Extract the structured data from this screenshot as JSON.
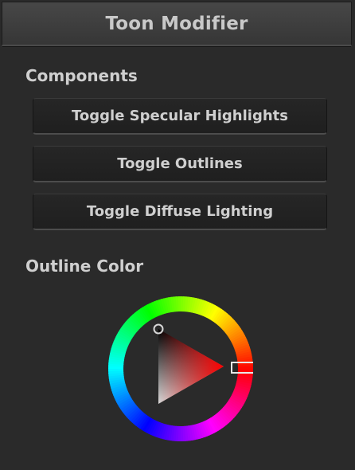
{
  "panel": {
    "title": "Toon Modifier"
  },
  "components": {
    "heading": "Components",
    "buttons": [
      {
        "label": "Toggle Specular Highlights"
      },
      {
        "label": "Toggle Outlines"
      },
      {
        "label": "Toggle Diffuse Lighting"
      }
    ]
  },
  "outline_color": {
    "heading": "Outline Color",
    "hue_color": "#ff0000"
  }
}
